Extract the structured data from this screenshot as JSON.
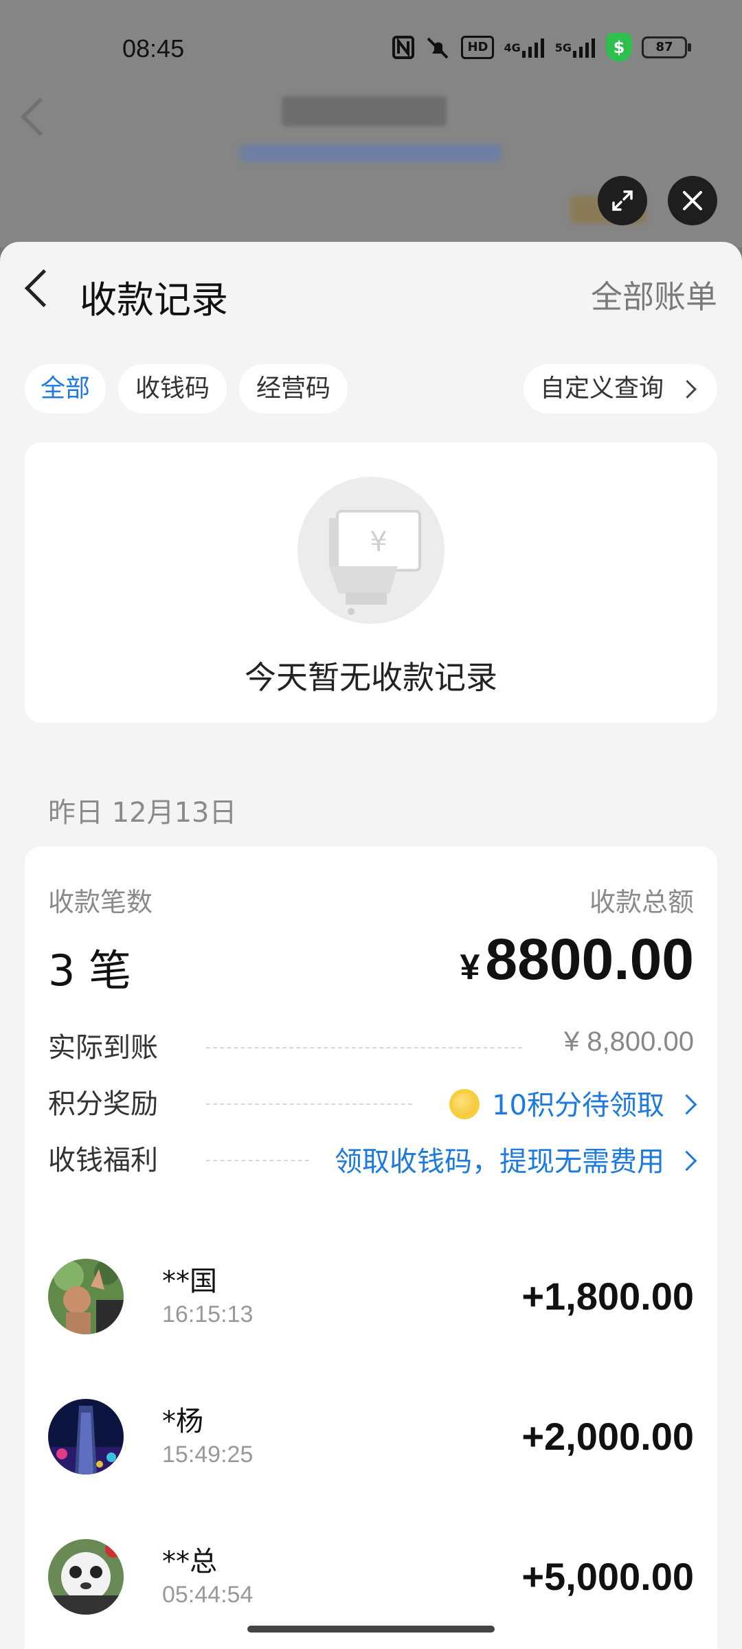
{
  "status_bar": {
    "time": "08:45",
    "icons": [
      "nfc-icon",
      "mute-bell-icon",
      "hd-icon",
      "4g-signal-icon",
      "5g-signal-icon",
      "shield-dollar-icon",
      "battery-icon"
    ],
    "hd_label": "HD",
    "net1": "4G",
    "net2": "5G",
    "battery": "87"
  },
  "sheet": {
    "title": "收款记录",
    "all_bills": "全部账单"
  },
  "filters": {
    "all": "全部",
    "qr": "收钱码",
    "business": "经营码",
    "custom": "自定义查询"
  },
  "empty_state": {
    "message": "今天暂无收款记录"
  },
  "yesterday": {
    "date_label": "昨日 12月13日",
    "count_label": "收款笔数",
    "count_value": "3 笔",
    "total_label": "收款总额",
    "currency": "¥",
    "total_value": "8800.00",
    "rows": [
      {
        "label": "实际到账",
        "value": "¥ 8,800.00"
      },
      {
        "label": "积分奖励",
        "value": "10积分待领取"
      },
      {
        "label": "收钱福利",
        "value": "领取收钱码，提现无需费用"
      }
    ],
    "transactions": [
      {
        "name": "**国",
        "time": "16:15:13",
        "amount": "+1,800.00"
      },
      {
        "name": "*杨",
        "time": "15:49:25",
        "amount": "+2,000.00"
      },
      {
        "name": "**总",
        "time": "05:44:54",
        "amount": "+5,000.00"
      }
    ]
  },
  "colors": {
    "accent_blue": "#1b79e0",
    "sheet_bg": "#f4f4f4",
    "overlay_bg": "#858585"
  }
}
